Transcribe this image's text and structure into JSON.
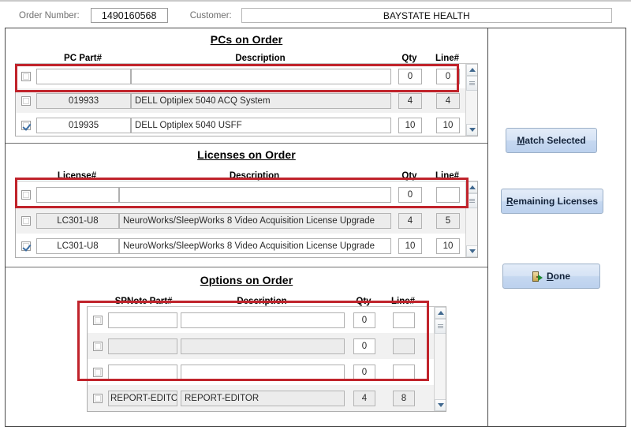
{
  "header": {
    "order_number_label": "Order Number:",
    "order_number_value": "1490160568",
    "customer_label": "Customer:",
    "customer_value": "BAYSTATE HEALTH"
  },
  "sections": {
    "pcs": {
      "title": "PCs on Order",
      "columns": [
        "PC Part#",
        "Description",
        "Qty",
        "Line#"
      ],
      "rows": [
        {
          "checked": false,
          "part": "",
          "description": "",
          "qty": "0",
          "line": "0",
          "readonly": false
        },
        {
          "checked": false,
          "part": "019933",
          "description": "DELL Optiplex 5040  ACQ System",
          "qty": "4",
          "line": "4",
          "readonly": true
        },
        {
          "checked": true,
          "part": "019935",
          "description": "DELL Optiplex 5040  USFF",
          "qty": "10",
          "line": "10",
          "readonly": false
        }
      ]
    },
    "licenses": {
      "title": "Licenses on Order",
      "columns": [
        "License#",
        "Description",
        "Qty",
        "Line#"
      ],
      "rows": [
        {
          "checked": false,
          "part": "",
          "description": "",
          "qty": "0",
          "line": "",
          "readonly": false
        },
        {
          "checked": false,
          "part": "LC301-U8",
          "description": "NeuroWorks/SleepWorks 8 Video Acquisition License Upgrade",
          "qty": "4",
          "line": "5",
          "readonly": true
        },
        {
          "checked": true,
          "part": "LC301-U8",
          "description": "NeuroWorks/SleepWorks 8 Video Acquisition License Upgrade",
          "qty": "10",
          "line": "10",
          "readonly": false
        }
      ]
    },
    "options": {
      "title": "Options on Order",
      "columns": [
        "SPNote Part#",
        "Description",
        "Qty",
        "Line#"
      ],
      "rows": [
        {
          "checked": false,
          "part": "",
          "description": "",
          "qty": "0",
          "line": "",
          "readonly": false
        },
        {
          "checked": false,
          "part": "",
          "description": "",
          "qty": "0",
          "line": "",
          "readonly": true
        },
        {
          "checked": false,
          "part": "",
          "description": "",
          "qty": "0",
          "line": "",
          "readonly": false
        },
        {
          "checked": false,
          "part": "REPORT-EDITOR",
          "description": "REPORT-EDITOR",
          "qty": "4",
          "line": "8",
          "readonly": true
        }
      ]
    }
  },
  "actions": {
    "match_selected": {
      "accel": "M",
      "rest": "atch Selected"
    },
    "remaining_licenses": {
      "accel": "R",
      "rest": "emaining Licenses"
    },
    "done": {
      "accel": "D",
      "rest": "one",
      "icon": "exit-door-icon"
    }
  },
  "colors": {
    "highlight": "#c0232b",
    "button_face": "#ccdcf2",
    "readonly_field": "#ececec"
  }
}
